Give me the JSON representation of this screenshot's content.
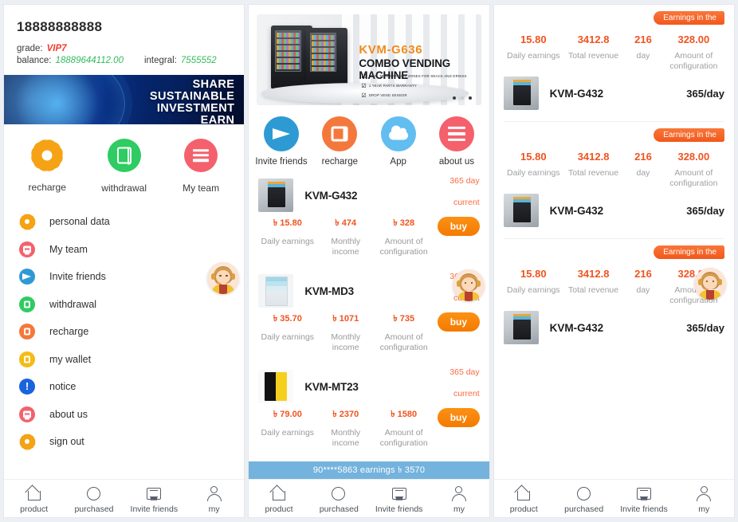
{
  "left": {
    "user": {
      "phone": "18888888888",
      "grade_label": "grade:",
      "grade_value": "VIP7",
      "balance_label": "balance:",
      "balance_value": "18889644112.00",
      "integral_label": "integral:",
      "integral_value": "7555552"
    },
    "banner": {
      "line1": "SHARE",
      "line2": "SUSTAINABLE",
      "line3": "INVESTMENT",
      "line4": "EARN"
    },
    "quick_actions": [
      {
        "label": "recharge",
        "icon": "gear-icon"
      },
      {
        "label": "withdrawal",
        "icon": "withdrawal-icon"
      },
      {
        "label": "My team",
        "icon": "team-list-icon"
      }
    ],
    "menu": [
      {
        "label": "personal data",
        "icon": "gear-icon"
      },
      {
        "label": "My team",
        "icon": "list-icon"
      },
      {
        "label": "Invite friends",
        "icon": "telegram-icon"
      },
      {
        "label": "withdrawal",
        "icon": "withdrawal-icon"
      },
      {
        "label": "recharge",
        "icon": "recharge-icon"
      },
      {
        "label": "my wallet",
        "icon": "wallet-icon"
      },
      {
        "label": "notice",
        "icon": "notice-icon"
      },
      {
        "label": "about us",
        "icon": "list-icon"
      },
      {
        "label": "sign out",
        "icon": "gear-icon"
      }
    ]
  },
  "middle": {
    "banner": {
      "model": "KVM-G636",
      "title": "COMBO VENDING MACHINE",
      "features": [
        "DUAL TEMPERATURE ZONES FOR SNACK AND DRINKS",
        "1 YEAR PARTS WARRANTY",
        "DROP VEND SENSOR"
      ],
      "dots": 3,
      "active_dot": 0
    },
    "quick_actions": [
      {
        "label": "Invite friends",
        "icon": "telegram-icon"
      },
      {
        "label": "recharge",
        "icon": "recharge-icon"
      },
      {
        "label": "App",
        "icon": "cloud-icon"
      },
      {
        "label": "about us",
        "icon": "list-icon"
      }
    ],
    "products": [
      {
        "name": "KVM-G432",
        "term": "365 day",
        "status": "current",
        "daily_value": "৳ 15.80",
        "daily_label": "Daily earnings",
        "monthly_value": "৳ 474",
        "monthly_label": "Monthly income",
        "config_value": "৳ 328",
        "config_label": "Amount of configuration",
        "buy_label": "buy",
        "thumb": "th-dark"
      },
      {
        "name": "KVM-MD3",
        "term": "365 day",
        "status": "current",
        "daily_value": "৳ 35.70",
        "daily_label": "Daily earnings",
        "monthly_value": "৳ 1071",
        "monthly_label": "Monthly income",
        "config_value": "৳ 735",
        "config_label": "Amount of configuration",
        "buy_label": "buy",
        "thumb": "th-white"
      },
      {
        "name": "KVM-MT23",
        "term": "365 day",
        "status": "current",
        "daily_value": "৳ 79.00",
        "daily_label": "Daily earnings",
        "monthly_value": "৳ 2370",
        "monthly_label": "Monthly income",
        "config_value": "৳ 1580",
        "config_label": "Amount of configuration",
        "buy_label": "buy",
        "thumb": "th-yellow"
      }
    ],
    "ticker": "90****5863 earnings ৳ 3570"
  },
  "right": {
    "orders": [
      {
        "tag": "Earnings in the",
        "daily_value": "15.80",
        "daily_label": "Daily earnings",
        "total_value": "3412.8",
        "total_label": "Total revenue",
        "day_value": "216",
        "day_label": "day",
        "config_value": "328.00",
        "config_label": "Amount of configuration",
        "name": "KVM-G432",
        "per_day": "365/day",
        "thumb": "th-dark"
      },
      {
        "tag": "Earnings in the",
        "daily_value": "15.80",
        "daily_label": "Daily earnings",
        "total_value": "3412.8",
        "total_label": "Total revenue",
        "day_value": "216",
        "day_label": "day",
        "config_value": "328.00",
        "config_label": "Amount of configuration",
        "name": "KVM-G432",
        "per_day": "365/day",
        "thumb": "th-dark"
      },
      {
        "tag": "Earnings in the",
        "daily_value": "15.80",
        "daily_label": "Daily earnings",
        "total_value": "3412.8",
        "total_label": "Total revenue",
        "day_value": "216",
        "day_label": "day",
        "config_value": "328.00",
        "config_label": "Amount of configuration",
        "name": "KVM-G432",
        "per_day": "365/day",
        "thumb": "th-dark"
      }
    ]
  },
  "tabbar": [
    {
      "label": "product",
      "icon": "home-icon"
    },
    {
      "label": "purchased",
      "icon": "circle-icon"
    },
    {
      "label": "Invite friends",
      "icon": "ticket-icon"
    },
    {
      "label": "my",
      "icon": "person-icon"
    }
  ],
  "colors": {
    "accent_orange": "#f1531f",
    "buy_orange": "#f57a00",
    "green": "#35bb5d",
    "red": "#ef3b2d",
    "ticker_blue": "#74b3dd"
  }
}
